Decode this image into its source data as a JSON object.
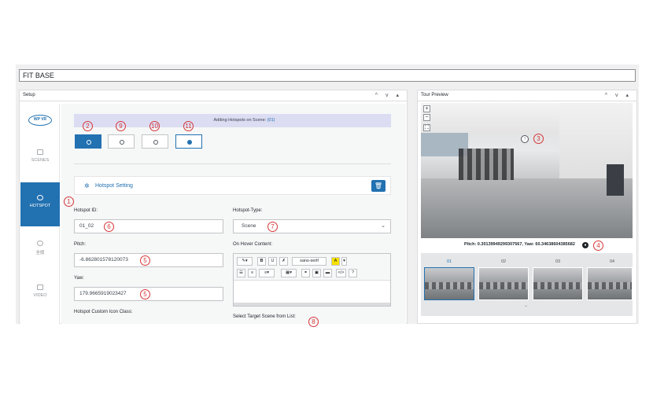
{
  "window": {
    "title": "FIT BASE"
  },
  "setup_panel": {
    "title": "Setup",
    "controls": "^ v ▴"
  },
  "preview_panel": {
    "title": "Tour Preview",
    "controls": "^ v ▴"
  },
  "sidebar": {
    "logo": "WP VR",
    "items": [
      {
        "label": "SCENES"
      },
      {
        "label": "HOTSPOT"
      },
      {
        "label": "全般"
      },
      {
        "label": "VIDEO"
      }
    ]
  },
  "hotspot_bar": {
    "prefix": "Adding Hotspots on Scene:",
    "scene": "(01)"
  },
  "setting": {
    "title": "Hotspot Setting"
  },
  "fields": {
    "hotspot_id_label": "Hotspot ID:",
    "hotspot_id_value": "01_02",
    "hotspot_type_label": "Hotspot-Type:",
    "hotspot_type_value": "Scene",
    "pitch_label": "Pitch:",
    "pitch_value": "-6.862801578120073",
    "on_hover_label": "On Hover Content:",
    "yaw_label": "Yaw:",
    "yaw_value": "179.9665919023427",
    "custom_icon_label": "Hotspot Custom Icon Class:",
    "target_scene_label": "Select Target Scene from List:"
  },
  "editor": {
    "font": "sans-serif",
    "bold": "B",
    "underline": "U",
    "code": "</>",
    "help": "?"
  },
  "preview": {
    "zoom_in": "+",
    "zoom_out": "−",
    "coords": "Pitch: 0.30139949299307567, Yaw: 60.34638604385682",
    "scenes": [
      "01",
      "02",
      "03",
      "04"
    ]
  },
  "annotations": [
    "1",
    "2",
    "3",
    "4",
    "5",
    "5",
    "6",
    "7",
    "8",
    "9",
    "10",
    "11"
  ],
  "colors": {
    "accent": "#2271b1",
    "annotation": "#d63638",
    "highlight": "#f7e100"
  }
}
